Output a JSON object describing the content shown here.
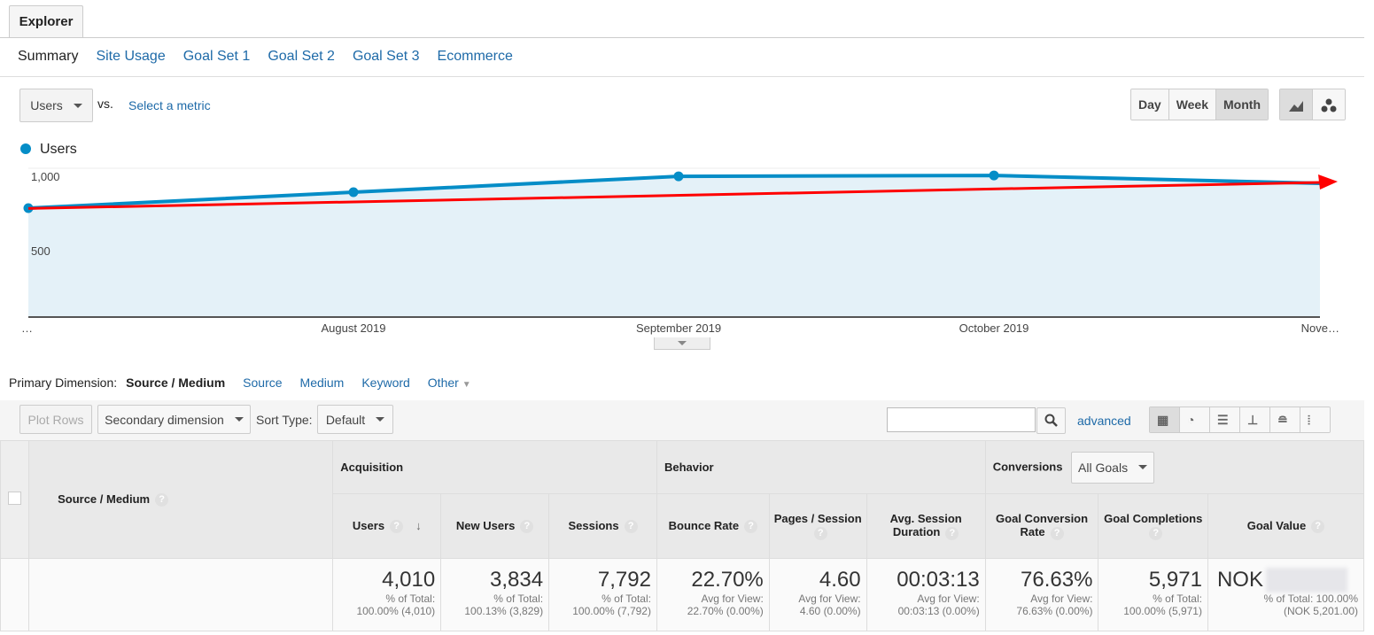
{
  "tab": "Explorer",
  "subtabs": [
    "Summary",
    "Site Usage",
    "Goal Set 1",
    "Goal Set 2",
    "Goal Set 3",
    "Ecommerce"
  ],
  "metric_select": "Users",
  "vs": "vs.",
  "select_metric": "Select a metric",
  "period": [
    "Day",
    "Week",
    "Month"
  ],
  "period_selected": "Month",
  "chart_icons": [
    "line-chart-icon",
    "motion-chart-icon"
  ],
  "chart_data": {
    "type": "area",
    "legend": "Users",
    "series_color": "#058dc7",
    "x": [
      "…",
      "August 2019",
      "September 2019",
      "October 2019",
      "Nove…"
    ],
    "y_ticks": [
      "1,000",
      "500"
    ],
    "ylim": [
      0,
      1000
    ],
    "values": [
      732,
      839,
      946,
      952,
      899
    ],
    "annotation": {
      "type": "trend-arrow",
      "color": "#ff0000",
      "from": 730,
      "to": 905
    }
  },
  "dimension": {
    "label": "Primary Dimension:",
    "active": "Source / Medium",
    "options": [
      "Source",
      "Medium",
      "Keyword",
      "Other"
    ]
  },
  "toolbar": {
    "plot_rows": "Plot Rows",
    "secondary": "Secondary dimension",
    "sort_type": "Sort Type:",
    "sort": "Default",
    "advanced": "advanced",
    "views": [
      "table-view-icon",
      "pie-view-icon",
      "performance-view-icon",
      "comparison-view-icon",
      "term-cloud-icon",
      "pivot-view-icon"
    ]
  },
  "table": {
    "dim_header": "Source / Medium",
    "groups": [
      "Acquisition",
      "Behavior",
      "Conversions"
    ],
    "goals": "All Goals",
    "columns": [
      {
        "h": "Users",
        "v": "4,010",
        "s1": "% of Total:",
        "s2": "100.00% (4,010)"
      },
      {
        "h": "New Users",
        "v": "3,834",
        "s1": "% of Total:",
        "s2": "100.13% (3,829)"
      },
      {
        "h": "Sessions",
        "v": "7,792",
        "s1": "% of Total:",
        "s2": "100.00% (7,792)"
      },
      {
        "h": "Bounce Rate",
        "v": "22.70%",
        "s1": "Avg for View:",
        "s2": "22.70% (0.00%)"
      },
      {
        "h": "Pages / Session",
        "v": "4.60",
        "s1": "Avg for View:",
        "s2": "4.60 (0.00%)"
      },
      {
        "h": "Avg. Session Duration",
        "v": "00:03:13",
        "s1": "Avg for View:",
        "s2": "00:03:13 (0.00%)"
      },
      {
        "h": "Goal Conversion Rate",
        "v": "76.63%",
        "s1": "Avg for View:",
        "s2": "76.63% (0.00%)"
      },
      {
        "h": "Goal Completions",
        "v": "5,971",
        "s1": "% of Total:",
        "s2": "100.00% (5,971)"
      },
      {
        "h": "Goal Value",
        "v": "NOK",
        "s1": "% of Total: 100.00%",
        "s2": "(NOK 5,201.00)"
      }
    ]
  }
}
